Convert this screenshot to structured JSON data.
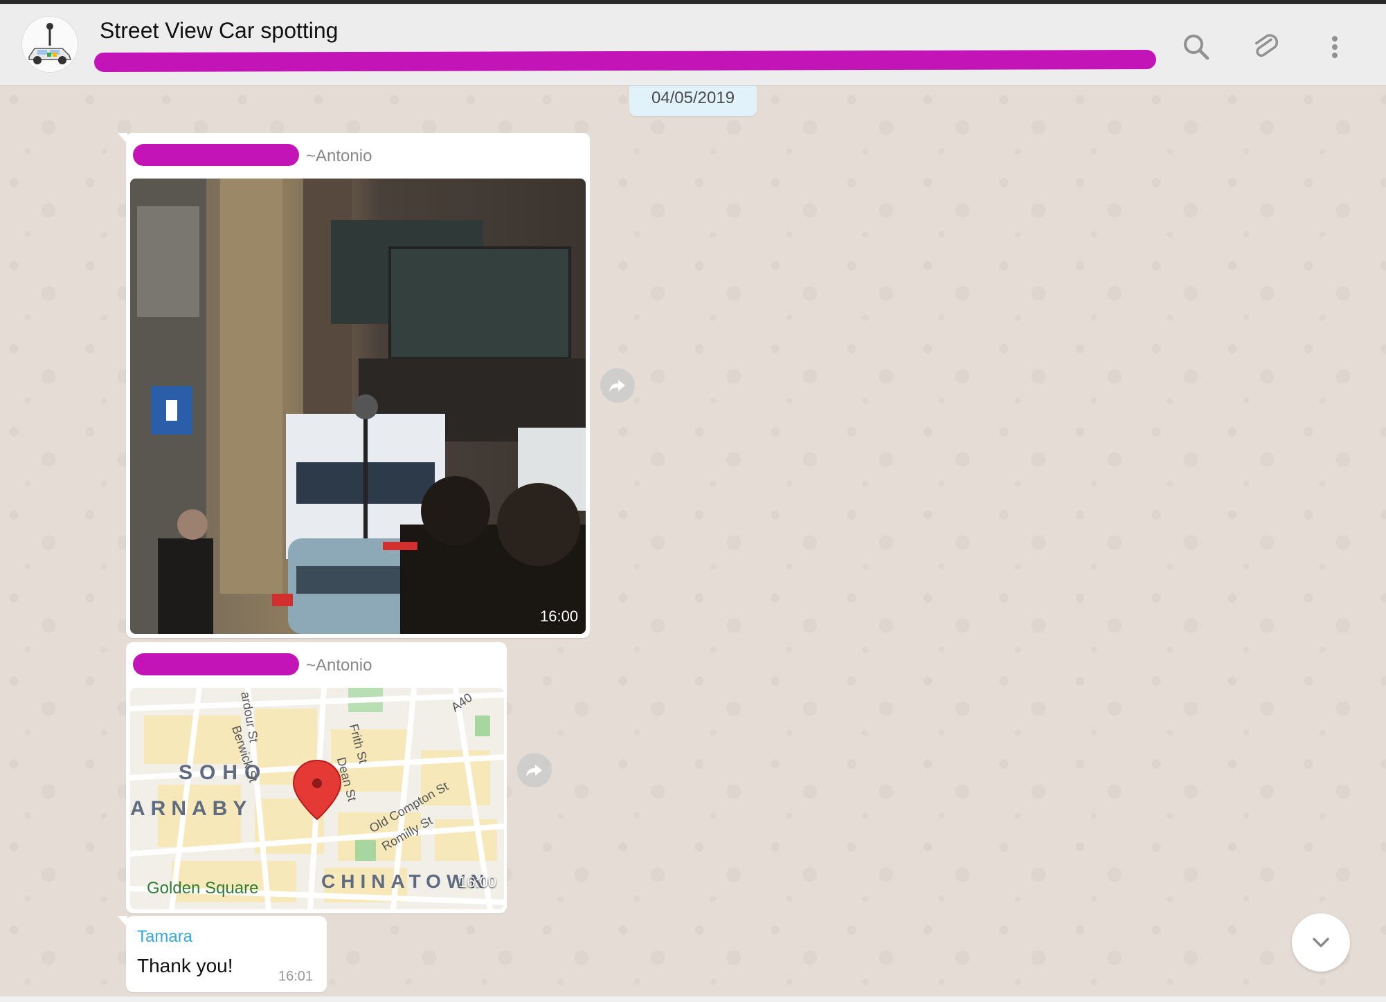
{
  "header": {
    "title": "Street View Car spotting",
    "icons": [
      "search-icon",
      "paperclip-icon",
      "more-vertical-icon"
    ]
  },
  "chat": {
    "date_chip": "04/05/2019",
    "messages": [
      {
        "type": "image",
        "sender": "~Antonio",
        "time": "16:00"
      },
      {
        "type": "location",
        "sender": "~Antonio",
        "time": "16:00",
        "map_labels": {
          "soho": "SOHO",
          "arnaby": "ARNABY",
          "chinatown": "CHINATOWN",
          "golden_square": "Golden Square",
          "wardour": "ardour St",
          "berwick": "Berwick St",
          "frith": "Frith St",
          "dean": "Dean St",
          "old_compton": "Old Compton St",
          "romilly": "Romilly St",
          "a40": "A40"
        }
      },
      {
        "type": "text",
        "sender": "Tamara",
        "text": "Thank you!",
        "time": "16:01"
      }
    ]
  },
  "colors": {
    "redaction": "#c315b7",
    "chat_bg": "#e5ddd5",
    "sender_tamara": "#35a8df"
  }
}
